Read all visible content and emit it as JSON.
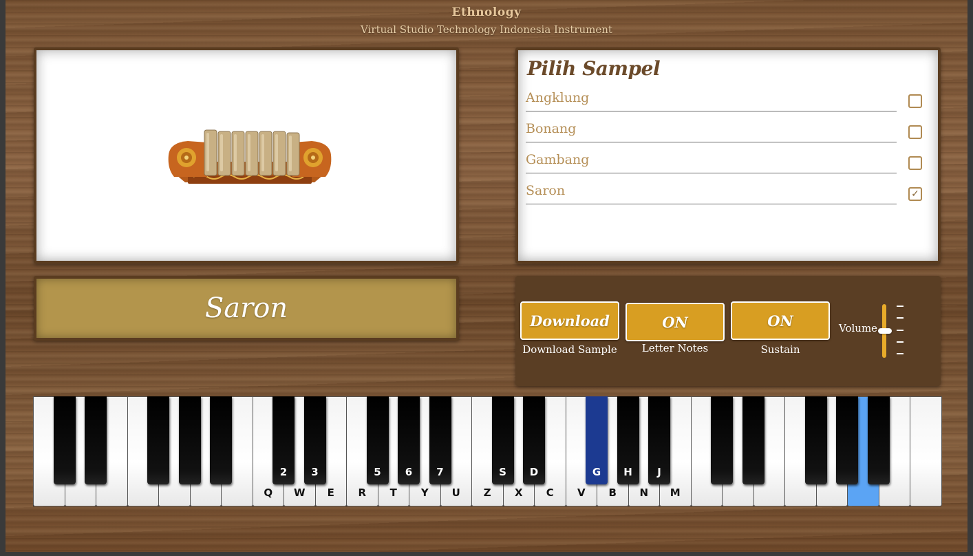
{
  "header": {
    "title": "Ethnology",
    "subtitle": "Virtual Studio Technology Indonesia Instrument"
  },
  "sample_list": {
    "title": "Pilih Sampel",
    "items": [
      {
        "label": "Angklung",
        "checked": false
      },
      {
        "label": "Bonang",
        "checked": false
      },
      {
        "label": "Gambang",
        "checked": false
      },
      {
        "label": "Saron",
        "checked": true
      }
    ],
    "check_glyph": "✓"
  },
  "instrument": {
    "name": "Saron",
    "image_icon": "saron-instrument-image"
  },
  "controls": {
    "download_label": "Download",
    "download_caption": "Download Sample",
    "letter_notes_label": "ON",
    "letter_notes_caption": "Letter Notes",
    "sustain_label": "ON",
    "sustain_caption": "Sustain",
    "volume_label": "Volume",
    "volume_level": 0.5
  },
  "piano": {
    "white_key_labels": [
      "",
      "",
      "",
      "",
      "",
      "",
      "",
      "Q",
      "W",
      "E",
      "R",
      "T",
      "Y",
      "U",
      "Z",
      "X",
      "C",
      "V",
      "B",
      "N",
      "M",
      "",
      "",
      "",
      "",
      "",
      "",
      "",
      ""
    ],
    "black_key_labels": [
      "",
      "",
      "",
      "",
      "",
      "2",
      "3",
      "5",
      "6",
      "7",
      "S",
      "D",
      "G",
      "H",
      "J",
      "",
      "",
      "",
      "",
      ""
    ],
    "active_white_key": 26,
    "active_black_key": 12
  },
  "colors": {
    "accent": "#d89e22",
    "name_panel": "#b3954c",
    "controls_bg": "#5a3e24",
    "list_text": "#b58f57",
    "active_white": "#5ba4f4",
    "active_black": "#1c3a91"
  }
}
